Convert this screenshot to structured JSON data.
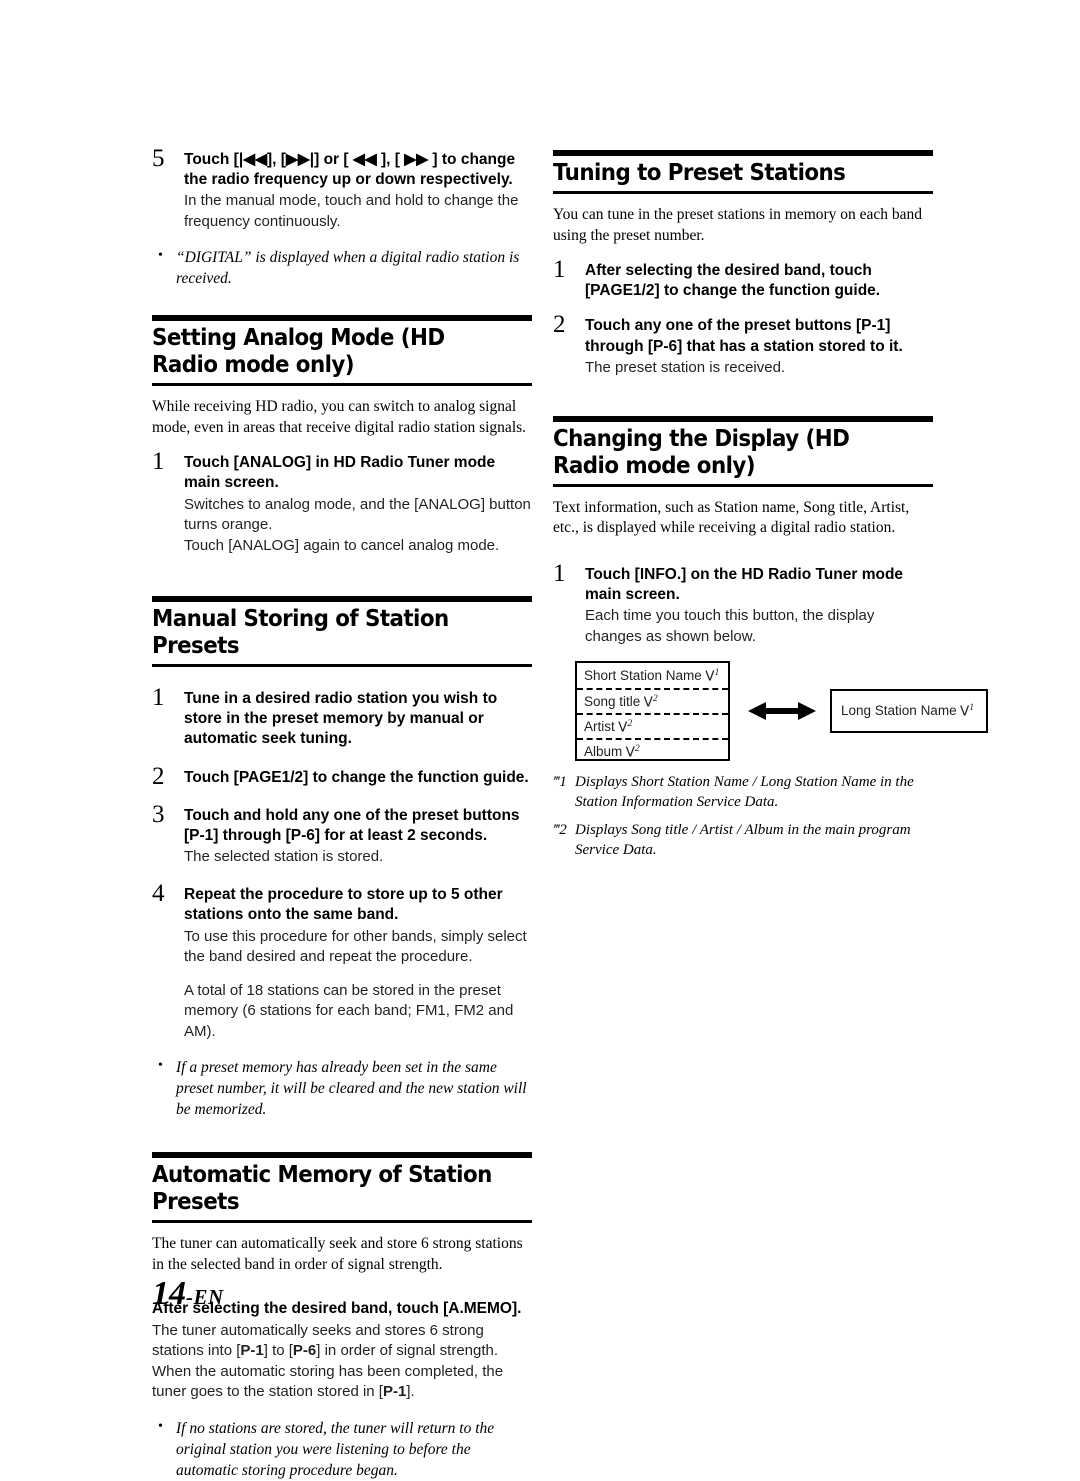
{
  "page": {
    "number_label": "14",
    "number_suffix": "-EN"
  },
  "left_column": {
    "step5": {
      "number": "5",
      "title_prefix": "Touch [",
      "title_sym1": "|◀◀",
      "title_mid1": "], [",
      "title_sym2": "▶▶|",
      "title_mid2": "] or [ ",
      "title_sym3": "◀◀",
      "title_mid3": " ], [ ",
      "title_sym4": "▶▶",
      "title_suffix": " ] to change the radio frequency up or down respectively.",
      "body": "In the manual mode, touch and hold to change the frequency continuously."
    },
    "note_digital": "“DIGITAL” is displayed when a digital radio station is received.",
    "setting_analog": {
      "heading": "Setting Analog Mode (HD Radio mode only)",
      "intro": "While receiving HD radio, you can switch to analog signal mode, even in areas that receive digital radio station signals.",
      "step1": {
        "number": "1",
        "title_a": "Touch [",
        "title_key": "ANALOG",
        "title_b": "] in HD Radio Tuner mode main screen.",
        "body_a": "Switches to analog mode, and the [ANALOG] button turns orange.",
        "body_b": "Touch [ANALOG] again to cancel analog mode."
      }
    },
    "manual_storing": {
      "heading": "Manual Storing of Station Presets",
      "step1": {
        "number": "1",
        "title": "Tune in a desired radio station you wish to store in the preset memory by manual or automatic seek tuning."
      },
      "step2": {
        "number": "2",
        "title_a": "Touch [",
        "title_key": "PAGE1/2",
        "title_b": "] to change the function guide."
      },
      "step3": {
        "number": "3",
        "title_a": "Touch and hold any one of the preset buttons [",
        "title_key1": "P-1",
        "title_mid": "] through [",
        "title_key2": "P-6",
        "title_b": "] for at least 2 seconds.",
        "body": "The selected station is stored."
      },
      "step4": {
        "number": "4",
        "title": "Repeat the procedure to store up to 5 other stations onto the same band.",
        "body_a": "To use this procedure for other bands, simply select the band desired and repeat the procedure.",
        "body_b": "A total of 18 stations can be stored in the preset memory (6 stations for each band; FM1, FM2 and AM)."
      },
      "note": "If a preset memory has already been set in the same preset number, it will be cleared and the new station will be memorized."
    },
    "automatic_memory": {
      "heading": "Automatic Memory of Station Presets",
      "intro": "The tuner can automatically seek and store 6 strong stations in the selected band in order of signal strength.",
      "lead_a": "After selecting the desired band, touch [",
      "lead_key": "A.MEMO",
      "lead_b": "].",
      "body_1a": "The tuner automatically seeks and stores 6 strong stations into [",
      "body_1key1": "P-1",
      "body_1mid": "] to [",
      "body_1key2": "P-6",
      "body_1b": "] in order of signal strength.",
      "body_2a": "When the automatic storing has been completed, the tuner goes to the station stored in [",
      "body_2key": "P-1",
      "body_2b": "].",
      "note": "If no stations are stored, the tuner will return to the original station you were listening to before the automatic storing procedure began."
    }
  },
  "right_column": {
    "tuning_preset": {
      "heading": "Tuning to Preset Stations",
      "intro": "You can tune in the preset stations in memory on each band using the preset number.",
      "step1": {
        "number": "1",
        "title_a": "After selecting the desired band, touch [",
        "title_key": "PAGE1/2",
        "title_b": "] to change the function guide."
      },
      "step2": {
        "number": "2",
        "title_a": "Touch any one of the preset buttons [",
        "title_key1": "P-1",
        "title_mid": "] through [",
        "title_key2": "P-6",
        "title_b": "] that has a station stored to it.",
        "body": "The preset station is received."
      }
    },
    "changing_display": {
      "heading": "Changing the Display (HD Radio mode only)",
      "intro": "Text information, such as Station name, Song title, Artist, etc., is displayed while receiving a digital radio station.",
      "step1": {
        "number": "1",
        "title_a": "Touch [",
        "title_key": "INFO.",
        "title_b": "] on the HD Radio Tuner mode main screen.",
        "body": "Each time you touch this button, the display changes as shown below."
      },
      "diagram": {
        "left_rows": [
          {
            "label": "Short Station Name",
            "mark": "1"
          },
          {
            "label": "Song title",
            "mark": "2"
          },
          {
            "label": "Artist",
            "mark": "2"
          },
          {
            "label": "Album",
            "mark": "2"
          }
        ],
        "right_box": {
          "label": "Long Station Name",
          "mark": "1"
        },
        "arrow": "double-headed-arrow"
      },
      "footnotes": [
        {
          "mark": "‴1",
          "text": "Displays Short Station Name / Long Station Name in the Station Information Service Data."
        },
        {
          "mark": "‴2",
          "text": "Displays Song title / Artist / Album in the main program Service Data."
        }
      ]
    }
  }
}
